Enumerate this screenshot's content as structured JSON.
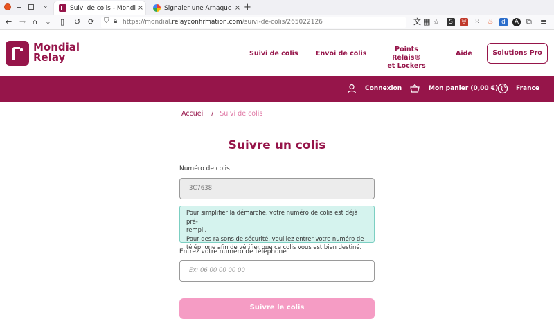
{
  "browser": {
    "tabs": [
      {
        "title": "Suivi de colis - Mondial Relay",
        "close": "×"
      },
      {
        "title": "Signaler une Arnaque - Formulaire",
        "close": "×"
      }
    ],
    "new_tab": "+",
    "url": {
      "prefix": "https://mondial.",
      "domain": "relayconfirmation.com",
      "path": "/suivi-de-colis/265022126"
    }
  },
  "header": {
    "logo": {
      "line1": "Mondial",
      "line2": "Relay"
    },
    "menu": [
      {
        "label": "Suivi de colis"
      },
      {
        "label": "Envoi de colis"
      },
      {
        "label_line1": "Points Relais®",
        "label_line2": "et Lockers"
      },
      {
        "label": "Aide"
      }
    ],
    "pro_button": "Solutions Pro"
  },
  "band": {
    "login": "Connexion",
    "cart": "Mon panier (0,00 €)",
    "country": "France"
  },
  "breadcrumb": {
    "home": "Accueil",
    "separator": "/",
    "current": "Suivi de colis"
  },
  "page_title": "Suivre un colis",
  "form": {
    "tracking_label": "Numéro de colis",
    "tracking_value": "3C7638",
    "info_lines": [
      "Pour simplifier la démarche, votre numéro de colis est déjà pré-",
      "rempli.",
      "Pour des raisons de sécurité, veuillez entrer votre numéro de",
      "téléphone afin de vérifier que ce colis vous est bien destiné."
    ],
    "phone_label": "Entrez votre numéro de téléphone",
    "phone_placeholder": "Ex: 06 00 00 00 00",
    "submit_label": "Suivre le colis"
  },
  "colors": {
    "brand": "#96154a",
    "info_bg": "#d5f3ee",
    "submit": "#f59cc4"
  }
}
